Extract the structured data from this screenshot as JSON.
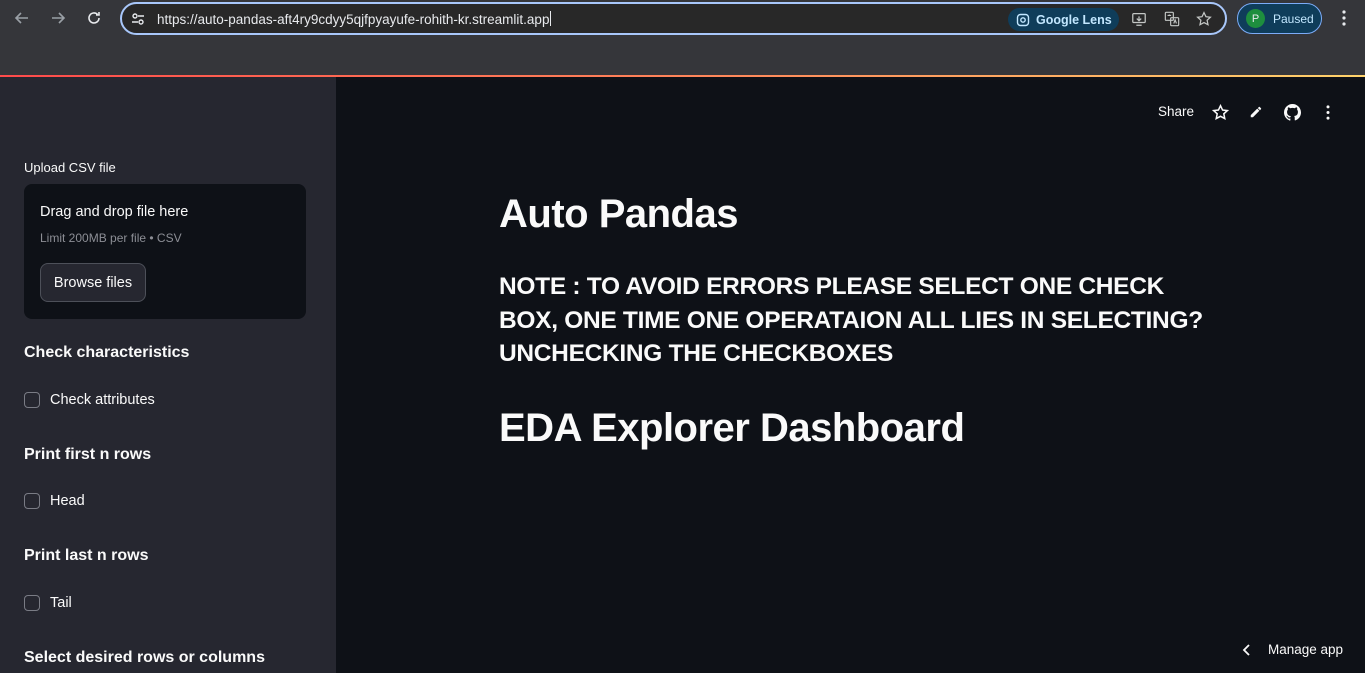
{
  "browser": {
    "url": "https://auto-pandas-aft4ry9cdyy5qjfpyayufe-rohith-kr.streamlit.app",
    "lens_label": "Google Lens",
    "profile_initial": "P",
    "profile_status": "Paused"
  },
  "sidebar": {
    "uploader_label": "Upload CSV file",
    "dropzone_title": "Drag and drop file here",
    "dropzone_limit": "Limit 200MB per file • CSV",
    "browse_label": "Browse files",
    "sections": [
      {
        "heading": "Check characteristics",
        "checkbox": "Check attributes"
      },
      {
        "heading": "Print first n rows",
        "checkbox": "Head"
      },
      {
        "heading": "Print last n rows",
        "checkbox": "Tail"
      },
      {
        "heading": "Select desired rows or columns"
      }
    ]
  },
  "toolbar": {
    "share_label": "Share"
  },
  "main": {
    "title": "Auto Pandas",
    "note": "NOTE : TO AVOID ERRORS PLEASE SELECT ONE CHECK BOX, ONE TIME ONE OPERATAION ALL LIES IN SELECTING? UNCHECKING THE CHECKBOXES",
    "subtitle": "EDA Explorer Dashboard"
  },
  "footer": {
    "manage_label": "Manage app"
  },
  "colors": {
    "app_bg": "#0e1117",
    "sidebar_bg": "#262730",
    "accent_gradient_start": "#ff4b4b",
    "accent_gradient_end": "#ffd36b"
  }
}
